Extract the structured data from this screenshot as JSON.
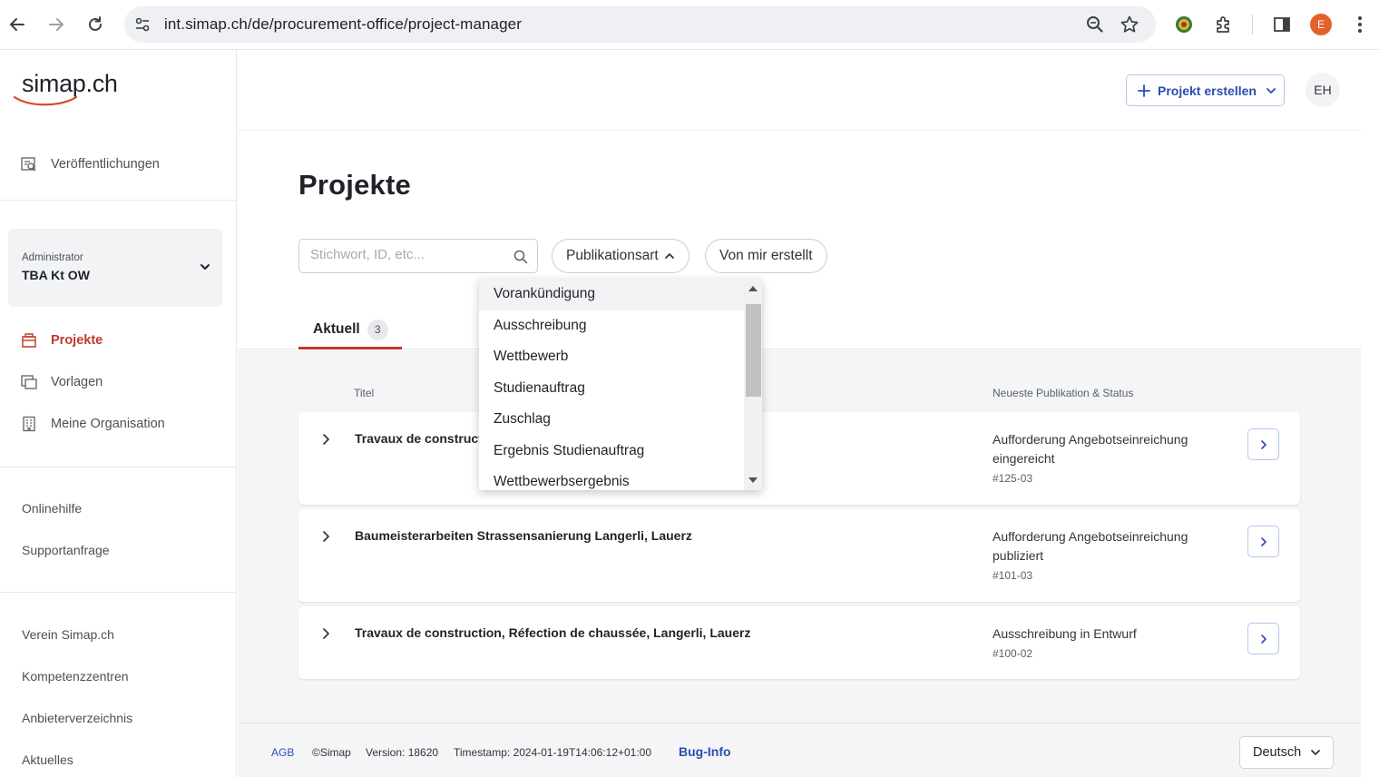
{
  "browser": {
    "url": "int.simap.ch/de/procurement-office/project-manager",
    "profile_initial": "E"
  },
  "sidebar": {
    "logo": "simap.ch",
    "publications_label": "Veröffentlichungen",
    "org": {
      "role": "Administrator",
      "name": "TBA Kt OW"
    },
    "items": [
      {
        "label": "Projekte",
        "icon": "projects-icon",
        "active": true
      },
      {
        "label": "Vorlagen",
        "icon": "templates-icon",
        "active": false
      },
      {
        "label": "Meine Organisation",
        "icon": "organization-icon",
        "active": false
      }
    ],
    "help_links": [
      "Onlinehilfe",
      "Supportanfrage"
    ],
    "info_links": [
      "Verein Simap.ch",
      "Kompetenzzentren",
      "Anbieterverzeichnis",
      "Aktuelles"
    ]
  },
  "header": {
    "create_button": "Projekt erstellen",
    "user_initials": "EH"
  },
  "page": {
    "title": "Projekte",
    "search_placeholder": "Stichwort, ID, etc...",
    "filter_publication_type": "Publikationsart",
    "filter_created_by_me": "Von mir erstellt",
    "tab_label": "Aktuell",
    "tab_count": "3"
  },
  "dropdown": {
    "options": [
      "Vorankündigung",
      "Ausschreibung",
      "Wettbewerb",
      "Studienauftrag",
      "Zuschlag",
      "Ergebnis Studienauftrag",
      "Wettbewerbsergebnis"
    ],
    "hovered_index": 0
  },
  "table": {
    "columns": {
      "title": "Titel",
      "status": "Neueste Publikation & Status"
    },
    "rows": [
      {
        "title": "Travaux de construct",
        "status": "Aufforderung Angebotseinreichung eingereicht",
        "pub_id": "#125-03"
      },
      {
        "title": "Baumeisterarbeiten Strassensanierung Langerli, Lauerz",
        "status": "Aufforderung Angebotseinreichung publiziert",
        "pub_id": "#101-03"
      },
      {
        "title": "Travaux de construction, Réfection de chaussée, Langerli, Lauerz",
        "status": "Ausschreibung in Entwurf",
        "pub_id": "#100-02"
      }
    ]
  },
  "footer": {
    "agb": "AGB",
    "copyright": "©Simap",
    "version": "Version: 18620",
    "timestamp": "Timestamp: 2024-01-19T14:06:12+01:00",
    "bug_info": "Bug-Info",
    "language": "Deutsch"
  },
  "colors": {
    "accent_red": "#c0392b",
    "link_blue": "#2a4db4",
    "background_gray": "#f4f5f7"
  }
}
